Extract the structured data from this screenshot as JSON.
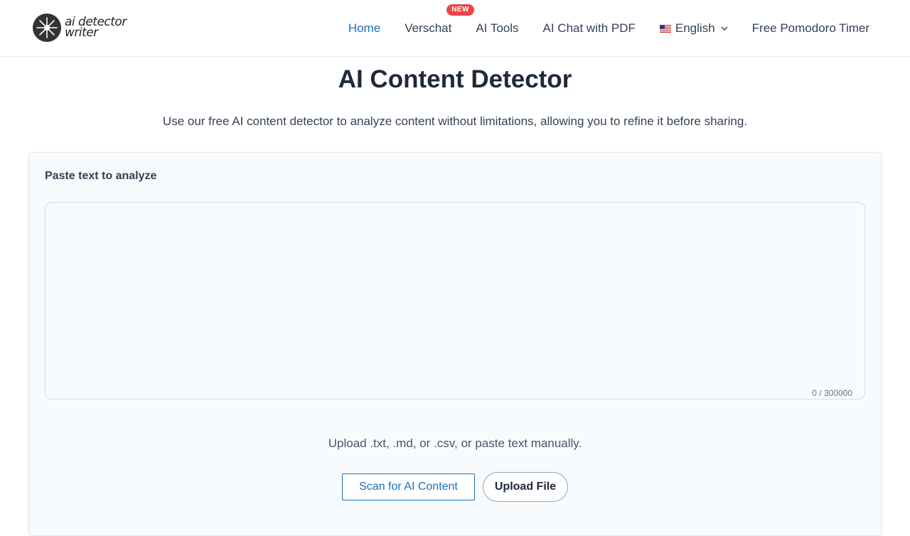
{
  "header": {
    "logo_line1": "ai detector",
    "logo_line2": "writer",
    "nav": [
      {
        "label": "Home",
        "active": true
      },
      {
        "label": "Verschat",
        "badge": "NEW"
      },
      {
        "label": "AI Tools"
      },
      {
        "label": "AI Chat with PDF"
      },
      {
        "label": "English",
        "icon": "us-flag-icon"
      },
      {
        "label": "Free Pomodoro Timer"
      }
    ]
  },
  "main": {
    "title": "AI Content Detector",
    "subtitle": "Use our free AI content detector to analyze content without limitations, allowing you to refine it before sharing.",
    "card": {
      "label": "Paste text to analyze",
      "textarea_value": "",
      "counter": "0 / 300000",
      "hint": "Upload .txt, .md, or .csv, or paste text manually.",
      "scan_button": "Scan for AI Content",
      "upload_button": "Upload File"
    }
  },
  "colors": {
    "accent": "#1d6fb8",
    "badge": "#ef4444",
    "text": "#1f2937"
  }
}
